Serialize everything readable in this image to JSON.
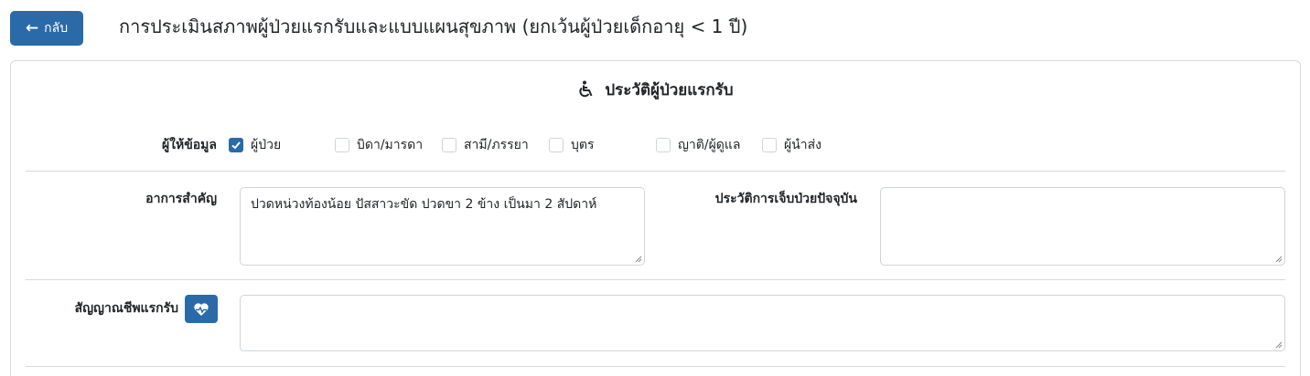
{
  "header": {
    "back_label": "กลับ",
    "title": "การประเมินสภาพผู้ป่วยแรกรับและแบบแผนสุขภาพ (ยกเว้นผู้ป่วยเด็กอายุ < 1 ปี)"
  },
  "section": {
    "title": "ประวัติผู้ป่วยแรกรับ",
    "icon": "wheelchair-icon"
  },
  "informant": {
    "label": "ผู้ให้ข้อมูล",
    "options": [
      {
        "label": "ผู้ป่วย",
        "checked": true
      },
      {
        "label": "บิดา/มารดา",
        "checked": false
      },
      {
        "label": "สามี/ภรรยา",
        "checked": false
      },
      {
        "label": "บุตร",
        "checked": false
      },
      {
        "label": "ญาติ/ผู้ดูแล",
        "checked": false
      },
      {
        "label": "ผู้นำส่ง",
        "checked": false
      }
    ]
  },
  "chief_complaint": {
    "label": "อาการสำคัญ",
    "value": "ปวดหน่วงท้องน้อย ปัสสาวะขัด ปวดขา 2 ข้าง เป็นมา 2 สัปดาห์"
  },
  "present_illness": {
    "label": "ประวัติการเจ็บป่วยปัจจุบัน",
    "value": ""
  },
  "vital_signs": {
    "label": "สัญญาณชีพแรกรับ",
    "button_icon": "heart-pulse-icon",
    "value": ""
  },
  "colors": {
    "primary": "#2a6aa8",
    "border": "#d7d9dc"
  }
}
